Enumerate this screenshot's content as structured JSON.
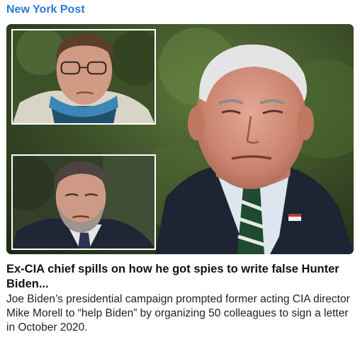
{
  "feed_item": {
    "source": "New York Post",
    "headline": "Ex-CIA chief spills on how he got spies to write false Hunter Biden...",
    "summary": "Joe Biden’s presidential campaign prompted former acting CIA director Mike Morell to “help Biden” by organizing 50 colleagues to sign a letter in October 2020."
  },
  "colors": {
    "source_link": "#2a7bd4",
    "headline_text": "#111111",
    "summary_text": "#222222",
    "inset_border": "#ffffff"
  }
}
